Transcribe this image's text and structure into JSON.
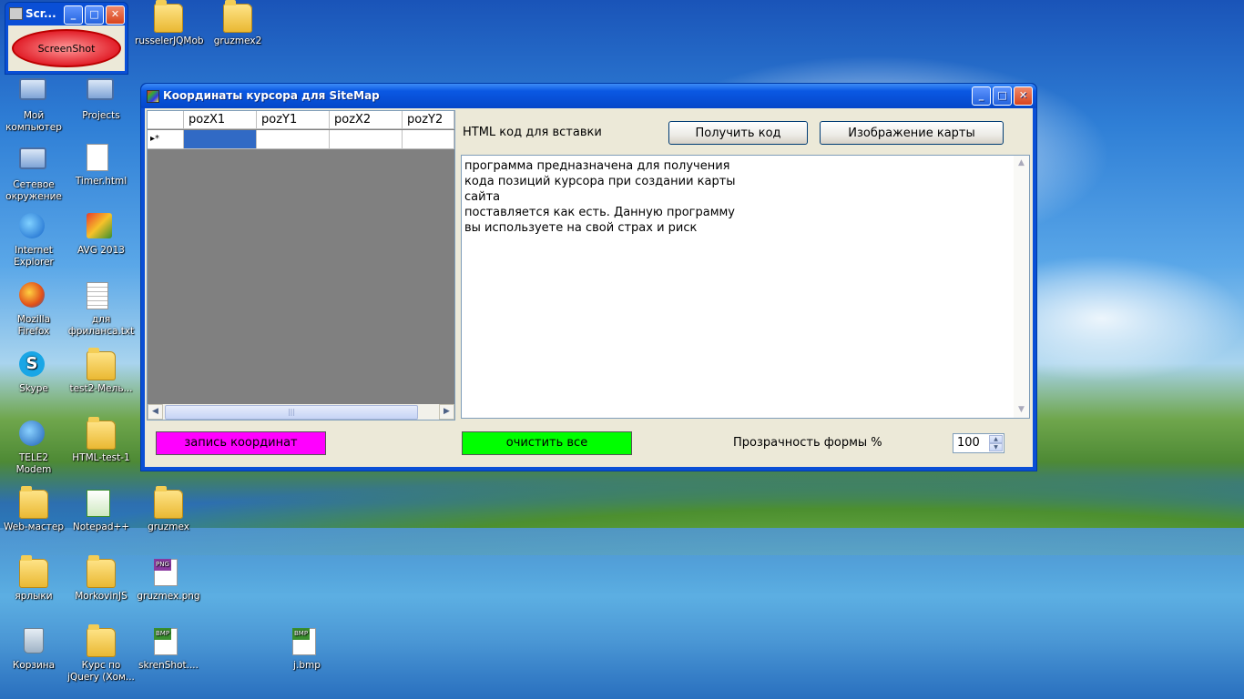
{
  "desktop": {
    "icons": [
      {
        "label": "russelerJQMob"
      },
      {
        "label": "gruzmex2"
      },
      {
        "label": "Мой компьютер"
      },
      {
        "label": "Projects"
      },
      {
        "label": "Сетевое окружение"
      },
      {
        "label": "Timer.html"
      },
      {
        "label": "Internet Explorer"
      },
      {
        "label": "AVG 2013"
      },
      {
        "label": "Mozilla Firefox"
      },
      {
        "label": "для фрилансa.txt"
      },
      {
        "label": "Skype"
      },
      {
        "label": "test2-Мель..."
      },
      {
        "label": "TELE2 Modem"
      },
      {
        "label": "HTML-test-1"
      },
      {
        "label": "Web-мастер"
      },
      {
        "label": "Notepad++"
      },
      {
        "label": "gruzmex"
      },
      {
        "label": "ярлыки"
      },
      {
        "label": "MorkovinJS"
      },
      {
        "label": "gruzmex.png"
      },
      {
        "label": "Корзина"
      },
      {
        "label": "Курс по jQuery (Хом..."
      },
      {
        "label": "skrenShot...."
      },
      {
        "label": "j.bmp"
      }
    ]
  },
  "mini_window": {
    "title": "Scr...",
    "button_label": "ScreenShot"
  },
  "window": {
    "title": "Координаты курсора для SiteMap",
    "grid": {
      "columns": [
        "pozX1",
        "pozY1",
        "pozX2",
        "pozY2"
      ],
      "new_row_marker": "▸*"
    },
    "html_label": "HTML код для вставки",
    "get_code_button": "Получить код",
    "map_image_button": "Изображение карты",
    "textarea_text": "программа предназначена для получения\nкода позиций курсора при создании карты\nсайта\nпоставляется как есть. Данную программу\nвы используете на свой страх и риск",
    "record_button": "запись координат",
    "clear_button": "очистить все",
    "opacity_label": "Прозрачность формы %",
    "opacity_value": "100"
  },
  "colors": {
    "record_button_bg": "#ff00ff",
    "clear_button_bg": "#00ff00",
    "title_bar": "#0a58e3"
  }
}
